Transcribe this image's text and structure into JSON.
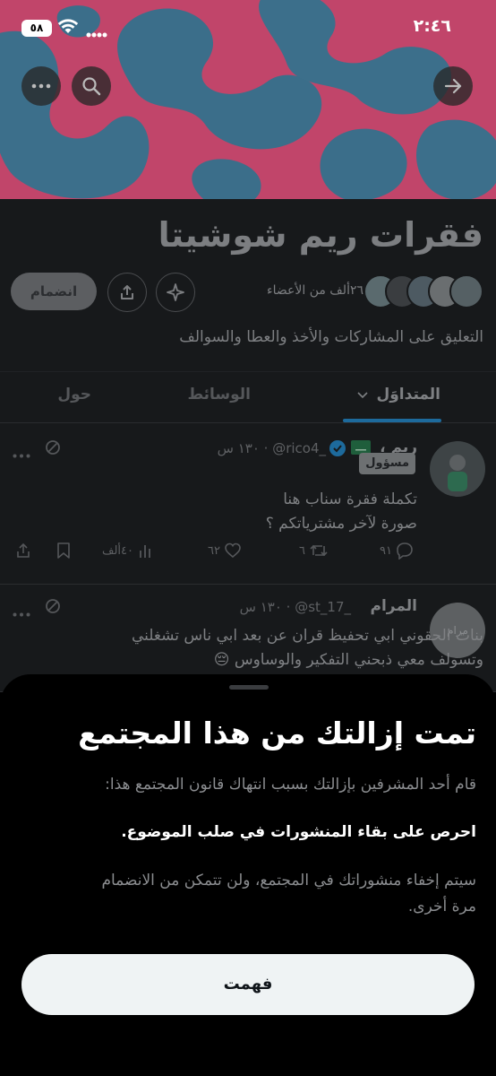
{
  "status_bar": {
    "time": "٢:٤٦",
    "battery": "٥٨"
  },
  "community": {
    "title": "فقرات ريم شوشيتا",
    "members_text": "٢٦ألف من الأعضاء",
    "description": "التعليق على المشاركات والأخذ والعطا والسوالف",
    "join_label": "انضمام"
  },
  "tabs": [
    {
      "label": "المتداوَل",
      "active": true
    },
    {
      "label": "الوسائط"
    },
    {
      "label": "حول"
    }
  ],
  "posts": [
    {
      "name": "ريم ،",
      "handle": "@rico4_",
      "time": "١٣٠ س",
      "badge": "مسؤول",
      "lines": [
        "تكملة فقرة سناب هنا",
        "صورة لآخر مشترياتكم ؟"
      ],
      "views": "٤٠ألف",
      "likes": "٦٢",
      "reposts": "٦",
      "replies": "٩١"
    },
    {
      "name": "المرام",
      "handle": "@st_17_",
      "time": "١٣٠ س",
      "avatar_text": "مرام",
      "lines": [
        "بنات الحقوني ابي تحفيظ قران عن بعد ابي ناس تشغلني",
        "وتسولف معي ذبحني التفكير والوساوس 😔"
      ]
    }
  ],
  "sheet": {
    "title": "تمت إزالتك من هذا المجتمع",
    "line1": "قام أحد المشرفين بإزالتك بسبب انتهاك قانون المجتمع هذا:",
    "rule": "احرص على بقاء المنشورات في صلب الموضوع.",
    "line3a": "سيتم إخفاء منشوراتك في المجتمع، ولن تتمكن من الانضمام",
    "line3b": "مرة أخرى.",
    "button": "فهمت"
  }
}
